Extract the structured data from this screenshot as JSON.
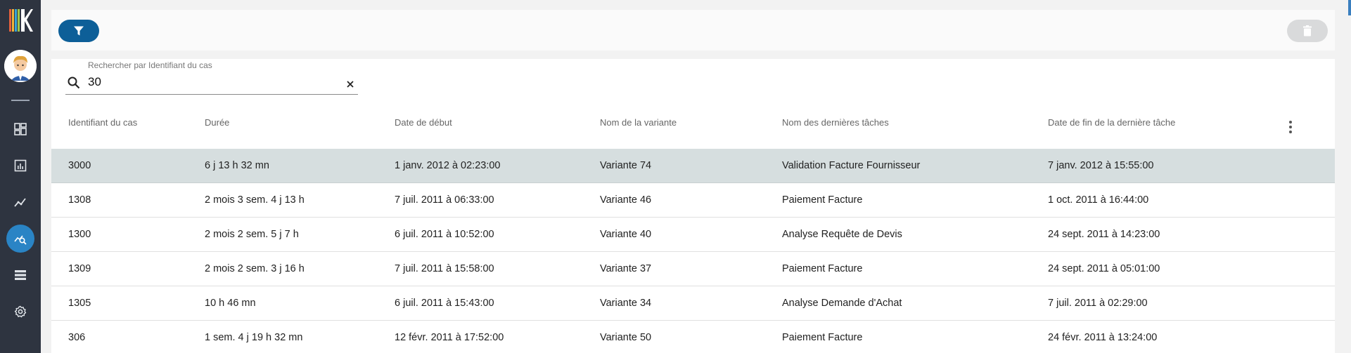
{
  "sidebar": {
    "items": [
      {
        "icon": "dashboard-icon"
      },
      {
        "icon": "bar-chart-icon"
      },
      {
        "icon": "trend-line-icon"
      },
      {
        "icon": "analysis-search-icon",
        "active": true
      },
      {
        "icon": "list-icon"
      },
      {
        "icon": "gear-icon"
      }
    ],
    "accent": "#2a84c5",
    "background": "#2e3440"
  },
  "toolbar": {
    "filter_icon": "filter-icon",
    "delete_icon": "trash-icon",
    "filter_color": "#0d5f98"
  },
  "search": {
    "label": "Rechercher par Identifiant du cas",
    "value": "30"
  },
  "table": {
    "columns": [
      "Identifiant du cas",
      "Durée",
      "Date de début",
      "Nom de la variante",
      "Nom des dernières tâches",
      "Date de fin de la dernière tâche"
    ],
    "rows": [
      [
        "3000",
        "6 j 13 h 32 mn",
        "1 janv. 2012 à 02:23:00",
        "Variante 74",
        "Validation Facture Fournisseur",
        "7 janv. 2012 à 15:55:00"
      ],
      [
        "1308",
        "2 mois 3 sem. 4 j 13 h",
        "7 juil. 2011 à 06:33:00",
        "Variante 46",
        "Paiement Facture",
        "1 oct. 2011 à 16:44:00"
      ],
      [
        "1300",
        "2 mois 2 sem. 5 j 7 h",
        "6 juil. 2011 à 10:52:00",
        "Variante 40",
        "Analyse Requête de Devis",
        "24 sept. 2011 à 14:23:00"
      ],
      [
        "1309",
        "2 mois 2 sem. 3 j 16 h",
        "7 juil. 2011 à 15:58:00",
        "Variante 37",
        "Paiement Facture",
        "24 sept. 2011 à 05:01:00"
      ],
      [
        "1305",
        "10 h 46 mn",
        "6 juil. 2011 à 15:43:00",
        "Variante 34",
        "Analyse Demande d'Achat",
        "7 juil. 2011 à 02:29:00"
      ],
      [
        "306",
        "1 sem. 4 j 19 h 32 mn",
        "12 févr. 2011 à 17:52:00",
        "Variante 50",
        "Paiement Facture",
        "24 févr. 2011 à 13:24:00"
      ]
    ],
    "selected_row": 0
  }
}
